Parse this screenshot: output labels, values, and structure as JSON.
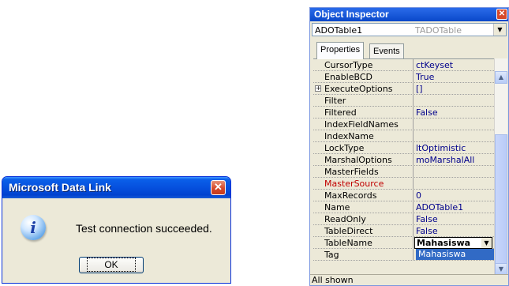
{
  "dialog": {
    "title": "Microsoft Data Link",
    "close_symbol": "✕",
    "icon": "info-icon",
    "icon_glyph": "i",
    "message": "Test connection succeeded.",
    "ok_label": "OK"
  },
  "inspector": {
    "title": "Object Inspector",
    "close_symbol": "✕",
    "object_name": "ADOTable1",
    "object_type": "TADOTable",
    "dropdown_arrow": "▼",
    "tabs": {
      "properties": "Properties",
      "events": "Events"
    },
    "rows": [
      {
        "name": "CursorType",
        "value": "ctKeyset"
      },
      {
        "name": "EnableBCD",
        "value": "True"
      },
      {
        "name": "ExecuteOptions",
        "value": "[]",
        "expandable": true
      },
      {
        "name": "Filter",
        "value": ""
      },
      {
        "name": "Filtered",
        "value": "False"
      },
      {
        "name": "IndexFieldNames",
        "value": ""
      },
      {
        "name": "IndexName",
        "value": ""
      },
      {
        "name": "LockType",
        "value": "ltOptimistic"
      },
      {
        "name": "MarshalOptions",
        "value": "moMarshalAll"
      },
      {
        "name": "MasterFields",
        "value": ""
      },
      {
        "name": "MasterSource",
        "value": ""
      },
      {
        "name": "MaxRecords",
        "value": "0"
      },
      {
        "name": "Name",
        "value": "ADOTable1"
      },
      {
        "name": "ReadOnly",
        "value": "False"
      },
      {
        "name": "TableDirect",
        "value": "False"
      },
      {
        "name": "TableName",
        "value": "Mahasiswa"
      },
      {
        "name": "Tag",
        "value": ""
      }
    ],
    "dropdown_option": "Mahasiswa",
    "status": "All shown"
  },
  "colors": {
    "title_bar": "#0650de",
    "highlight": "#316ac5",
    "value_text": "#00008b",
    "red_property": "#c00000"
  }
}
